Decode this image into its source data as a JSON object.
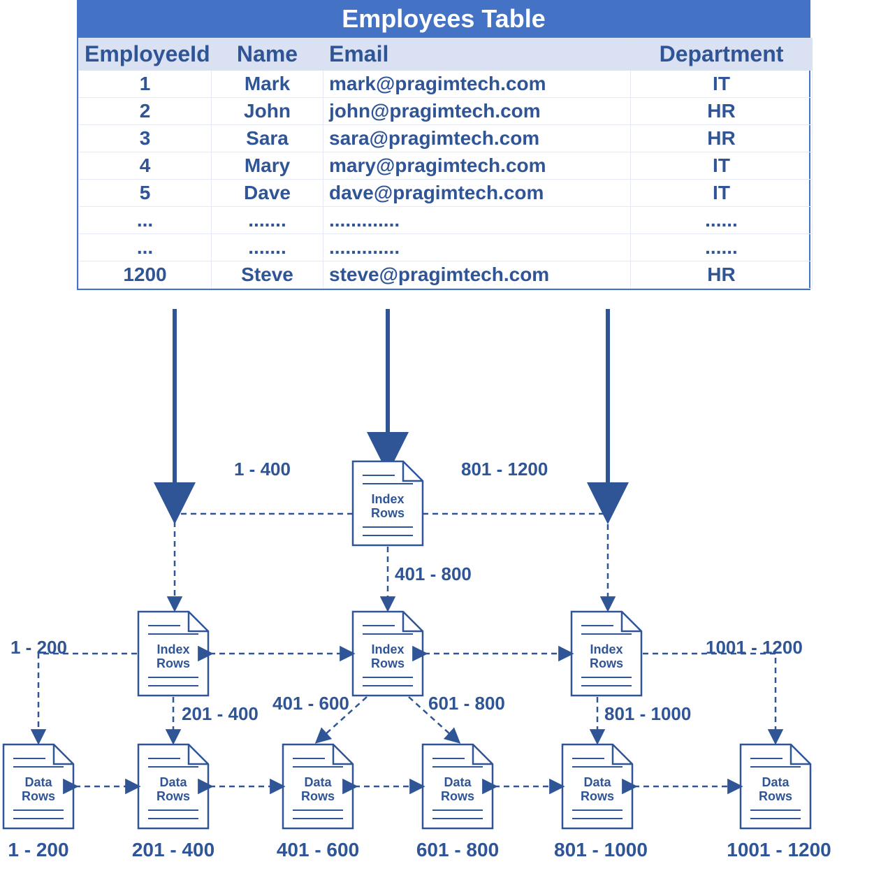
{
  "table": {
    "title": "Employees Table",
    "headers": [
      "EmployeeId",
      "Name",
      "Email",
      "Department"
    ],
    "rows": [
      [
        "1",
        "Mark",
        "mark@pragimtech.com",
        "IT"
      ],
      [
        "2",
        "John",
        "john@pragimtech.com",
        "HR"
      ],
      [
        "3",
        "Sara",
        "sara@pragimtech.com",
        "HR"
      ],
      [
        "4",
        "Mary",
        "mary@pragimtech.com",
        "IT"
      ],
      [
        "5",
        "Dave",
        "dave@pragimtech.com",
        "IT"
      ],
      [
        "...",
        ".......",
        ".............",
        "......"
      ],
      [
        "...",
        ".......",
        ".............",
        "......"
      ],
      [
        "1200",
        "Steve",
        "steve@pragimtech.com",
        "HR"
      ]
    ]
  },
  "tree": {
    "root_label": "Index\nRows",
    "root_left_range": "1 - 400",
    "root_down_range": "401 - 800",
    "root_right_range": "801 - 1200",
    "mid": [
      {
        "label": "Index\nRows",
        "left_range": "1 - 200",
        "right_range": "201 - 400"
      },
      {
        "label": "Index\nRows",
        "left_range": "401 - 600",
        "right_range": "601 - 800"
      },
      {
        "label": "Index\nRows",
        "left_range": "801 - 1000",
        "right_range": "1001 - 1200"
      }
    ],
    "leaves": [
      {
        "label": "Data\nRows",
        "range": "1 - 200"
      },
      {
        "label": "Data\nRows",
        "range": "201 - 400"
      },
      {
        "label": "Data\nRows",
        "range": "401 - 600"
      },
      {
        "label": "Data\nRows",
        "range": "601 - 800"
      },
      {
        "label": "Data\nRows",
        "range": "801 - 1000"
      },
      {
        "label": "Data\nRows",
        "range": "1001 - 1200"
      }
    ]
  },
  "colors": {
    "primary": "#2f5597",
    "header_bg": "#4472c4",
    "subheader_bg": "#d9e1f2"
  }
}
